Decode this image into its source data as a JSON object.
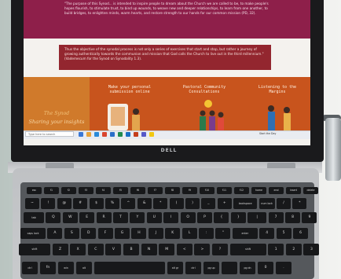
{
  "screen": {
    "quote1": "\"The purpose of this Synod... is intended to inspire people to dream about the Church we are called to be, to make people's hopes flourish, to stimulate trust, to bind up wounds, to weave new and deeper relationships, to learn from one another, to build bridges, to enlighten minds, warm hearts, and restore strength to our hands for our common mission (PD, 32).",
    "quote2": "Thus the objective of the synodal process is not only a series of exercises that start and stop, but rather a journey of growing authentically towards the communion and mission that God calls the Church to live out in the third millennium.\" (Vademecum for the Synod on Synodality 1.3).",
    "poster": {
      "title": "The Synod",
      "subtitle": "Sharing your insights",
      "heading1": "Make your personal submission online",
      "heading2": "Pastoral Community Consultations",
      "heading3": "Listening to the Margins"
    },
    "taskbar": {
      "search_placeholder": "Type here to search",
      "tray_text": "Start the Day"
    }
  },
  "brand": "DELL",
  "keyboard": {
    "row_fn": [
      "esc",
      "f1",
      "f2",
      "f3",
      "f4",
      "f5",
      "f6",
      "f7",
      "f8",
      "f9",
      "f10",
      "f11",
      "f12",
      "home",
      "end",
      "insert",
      "delete"
    ],
    "row_num": [
      "~",
      "!",
      "@",
      "#",
      "$",
      "%",
      "^",
      "&",
      "*",
      "(",
      ")",
      "_",
      "+",
      "backspace",
      "num lock",
      "/",
      "*",
      "-"
    ],
    "row_q": [
      "tab",
      "Q",
      "W",
      "E",
      "R",
      "T",
      "Y",
      "U",
      "I",
      "O",
      "P",
      "{",
      "}",
      "|",
      "7",
      "8",
      "9"
    ],
    "row_a": [
      "caps lock",
      "A",
      "S",
      "D",
      "F",
      "G",
      "H",
      "J",
      "K",
      "L",
      ":",
      "\"",
      "enter",
      "4",
      "5",
      "6",
      "+"
    ],
    "row_z": [
      "shift",
      "Z",
      "X",
      "C",
      "V",
      "B",
      "N",
      "M",
      "<",
      ">",
      "?",
      "shift",
      "1",
      "2",
      "3"
    ],
    "row_ctl": [
      "ctrl",
      "fn",
      "win",
      "alt",
      "",
      "alt gr",
      "ctrl",
      "pg up",
      "",
      "pg dn",
      "0",
      "."
    ]
  }
}
